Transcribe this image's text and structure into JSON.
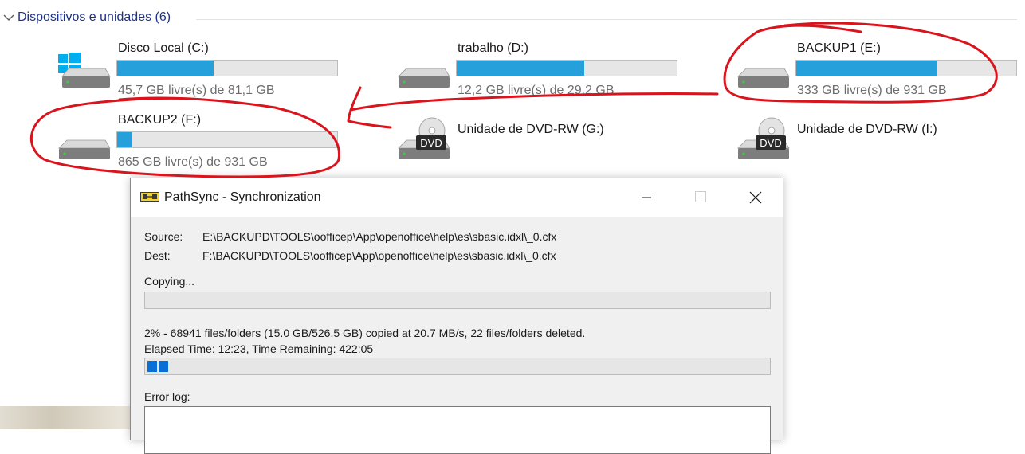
{
  "section": {
    "title": "Dispositivos e unidades (6)"
  },
  "drives": [
    {
      "name": "Disco Local (C:)",
      "free_text": "45,7 GB livre(s) de 81,1 GB",
      "used_fraction": 0.44,
      "icon": "windows-drive-icon"
    },
    {
      "name": "trabalho (D:)",
      "free_text": "12,2 GB livre(s) de 29,2 GB",
      "used_fraction": 0.58,
      "icon": "hard-drive-icon"
    },
    {
      "name": "BACKUP1 (E:)",
      "free_text": "333 GB livre(s) de 931 GB",
      "used_fraction": 0.64,
      "icon": "hard-drive-icon"
    },
    {
      "name": "BACKUP2 (F:)",
      "free_text": "865 GB livre(s) de 931 GB",
      "used_fraction": 0.07,
      "icon": "hard-drive-icon"
    },
    {
      "name": "Unidade de DVD-RW (G:)",
      "icon": "dvd-drive-icon",
      "icon_label": "DVD"
    },
    {
      "name": "Unidade de DVD-RW (I:)",
      "icon": "dvd-drive-icon",
      "icon_label": "DVD"
    }
  ],
  "dialog": {
    "title": "PathSync - Synchronization",
    "source_label": "Source:",
    "source_path": "E:\\BACKUPD\\TOOLS\\oofficep\\App\\openoffice\\help\\es\\sbasic.idxl\\_0.cfx",
    "dest_label": "Dest:",
    "dest_path": "F:\\BACKUPD\\TOOLS\\oofficep\\App\\openoffice\\help\\es\\sbasic.idxl\\_0.cfx",
    "copying_label": "Copying...",
    "file_progress_percent": 0,
    "stats_line": "2% - 68941 files/folders (15.0 GB/526.5 GB) copied at 20.7 MB/s, 22 files/folders deleted.",
    "time_line": "Elapsed Time: 12:23, Time Remaining: 422:05",
    "total_progress_percent": 2,
    "error_log_label": "Error log:"
  },
  "colors": {
    "bar_fill": "#26a0da",
    "progress_block": "#0a6fd4",
    "annotation_red": "#d9141c",
    "section_title": "#1e3287"
  }
}
